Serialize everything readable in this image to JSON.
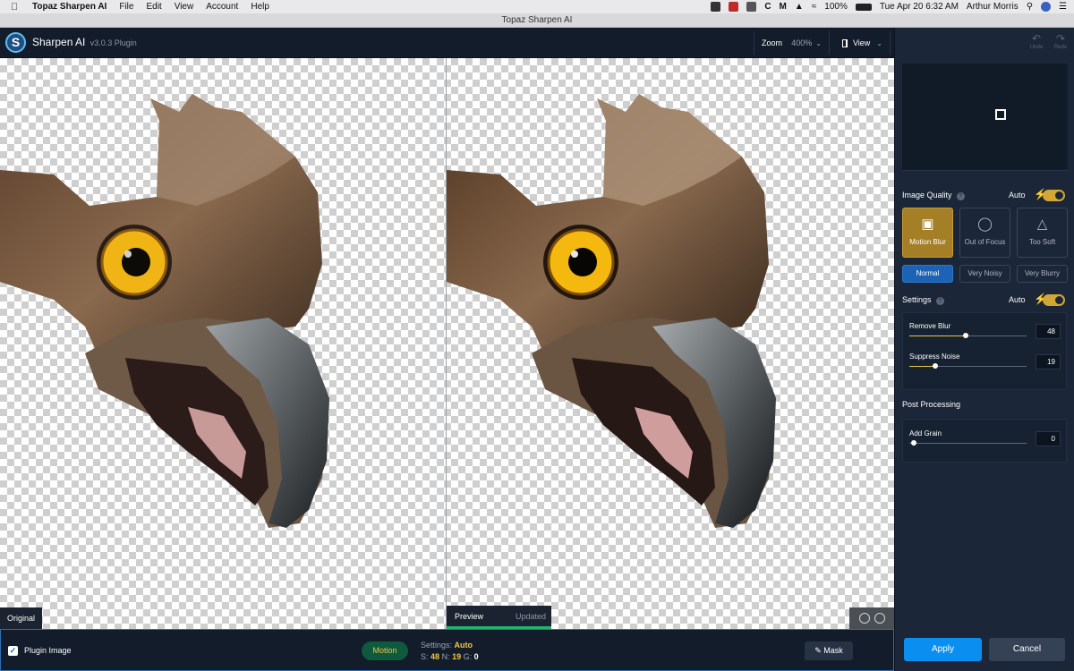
{
  "menubar": {
    "app_name": "Topaz Sharpen AI",
    "items": [
      "File",
      "Edit",
      "View",
      "Account",
      "Help"
    ],
    "battery": "100%",
    "datetime": "Tue Apr 20  6:32 AM",
    "user": "Arthur Morris"
  },
  "window": {
    "title": "Topaz Sharpen AI"
  },
  "header": {
    "app_name": "Sharpen AI",
    "version": "v3.0.3 Plugin",
    "zoom_label": "Zoom",
    "zoom_value": "400%",
    "view_label": "View"
  },
  "canvas": {
    "original_label": "Original",
    "preview_label": "Preview",
    "updated_label": "Updated"
  },
  "bottom": {
    "plugin_image_label": "Plugin Image",
    "model_pill": "Motion",
    "settings_label": "Settings:",
    "settings_value": "Auto",
    "s_label": "S:",
    "s_value": "48",
    "n_label": "N:",
    "n_value": "19",
    "g_label": "G:",
    "g_value": "0",
    "mask_label": "Mask"
  },
  "panel": {
    "undo_label": "Undo",
    "redo_label": "Redo",
    "image_quality_label": "Image Quality",
    "auto_label": "Auto",
    "quality_modes": [
      "Motion Blur",
      "Out of Focus",
      "Too Soft"
    ],
    "noise_modes": [
      "Normal",
      "Very Noisy",
      "Very Blurry"
    ],
    "settings_label": "Settings",
    "settings_auto_label": "Auto",
    "remove_blur_label": "Remove Blur",
    "remove_blur_value": "48",
    "suppress_noise_label": "Suppress Noise",
    "suppress_noise_value": "19",
    "post_processing_label": "Post Processing",
    "add_grain_label": "Add Grain",
    "add_grain_value": "0",
    "apply_label": "Apply",
    "cancel_label": "Cancel"
  },
  "colors": {
    "accent_yellow": "#f2c641",
    "apply_blue": "#0a8ff0",
    "active_mode": "#a57f26",
    "normal_active": "#1d63b5"
  }
}
